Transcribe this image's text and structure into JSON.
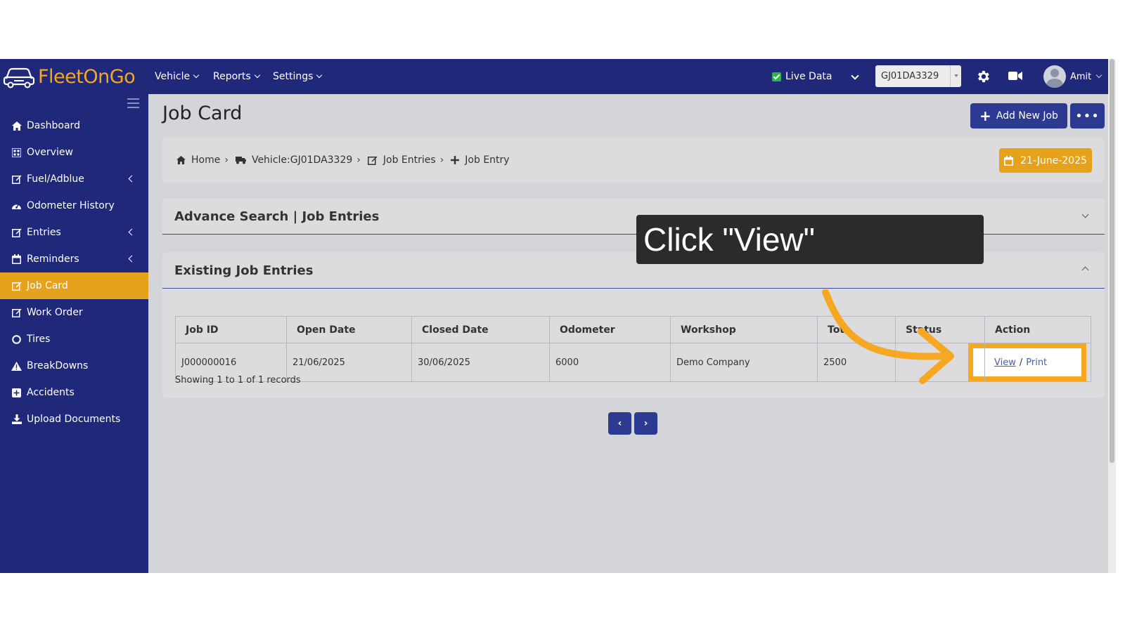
{
  "app": {
    "brand_part1": "Fleet",
    "brand_part2": "On",
    "brand_part3": "Go"
  },
  "topnav": {
    "menus": [
      "Vehicle",
      "Reports",
      "Settings"
    ],
    "live_data_label": "Live Data",
    "vehicle_selected": "GJ01DA3329",
    "user_name": "Amit"
  },
  "sidebar": {
    "items": [
      {
        "label": "Dashboard",
        "icon": "home-icon"
      },
      {
        "label": "Overview",
        "icon": "grid-icon"
      },
      {
        "label": "Fuel/Adblue",
        "icon": "edit-icon"
      },
      {
        "label": "Odometer History",
        "icon": "gauge-icon"
      },
      {
        "label": "Entries",
        "icon": "edit-icon"
      },
      {
        "label": "Reminders",
        "icon": "calendar-icon"
      },
      {
        "label": "Job Card",
        "icon": "edit-icon"
      },
      {
        "label": "Work Order",
        "icon": "edit-icon"
      },
      {
        "label": "Tires",
        "icon": "circle-icon"
      },
      {
        "label": "BreakDowns",
        "icon": "warning-icon"
      },
      {
        "label": "Accidents",
        "icon": "plus-square-icon"
      },
      {
        "label": "Upload Documents",
        "icon": "download-icon"
      }
    ]
  },
  "page": {
    "title": "Job Card",
    "add_button": "Add New Job",
    "more_button": "•••",
    "date": "21-June-2025"
  },
  "breadcrumb": {
    "home": "Home",
    "vehicle": "Vehicle:GJ01DA3329",
    "entries": "Job Entries",
    "entry": "Job Entry"
  },
  "search": {
    "title": "Advance Search | Job Entries"
  },
  "entries": {
    "title": "Existing Job Entries",
    "columns": [
      "Job ID",
      "Open Date",
      "Closed Date",
      "Odometer",
      "Workshop",
      "Tota",
      "Status",
      "Action"
    ],
    "rows": [
      {
        "job_id": "J000000016",
        "open_date": "21/06/2025",
        "closed_date": "30/06/2025",
        "odometer": "6000",
        "workshop": "Demo Company",
        "total": "2500",
        "status": "",
        "view": "View",
        "print": "Print"
      }
    ],
    "records_text": "Showing 1 to 1 of 1 records"
  },
  "pager": {
    "prev": "‹",
    "next": "›"
  },
  "overlay": {
    "instruction": "Click \"View\""
  }
}
